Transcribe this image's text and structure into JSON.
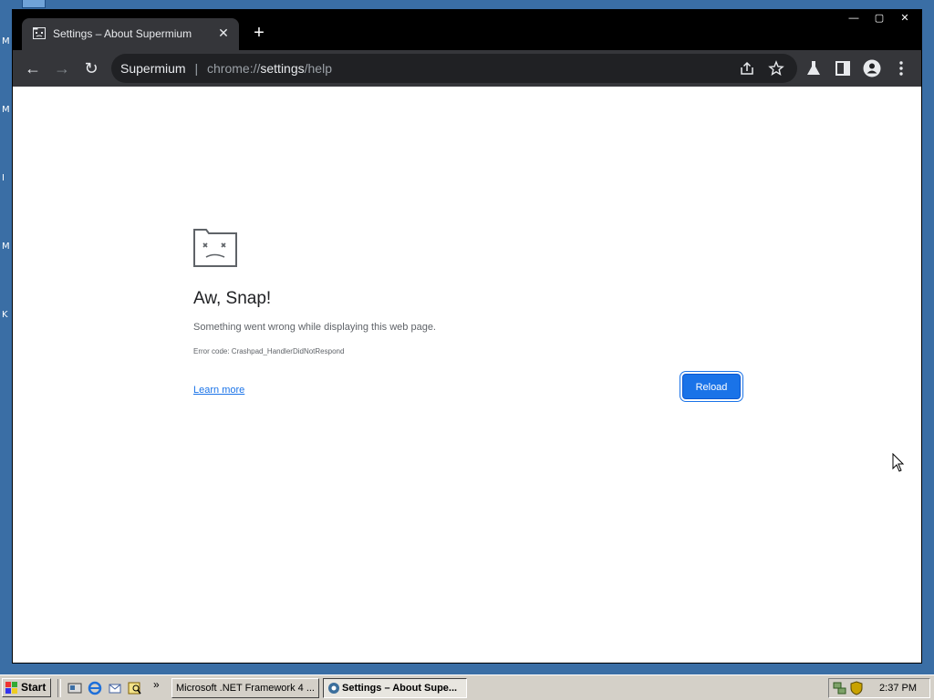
{
  "desktop": {
    "edge_letters": [
      "M",
      "M",
      "I",
      "M",
      "K"
    ]
  },
  "browser": {
    "tab": {
      "title": "Settings – About Supermium",
      "close_glyph": "✕"
    },
    "new_tab_glyph": "+",
    "window_controls": {
      "minimize": "—",
      "maximize": "▢",
      "close": "✕"
    },
    "toolbar": {
      "back_glyph": "←",
      "forward_glyph": "→",
      "reload_glyph": "↻",
      "omnibox": {
        "site_name": "Supermium",
        "separator": "|",
        "url_scheme": "chrome://",
        "url_host": "settings",
        "url_path": "/help"
      }
    }
  },
  "crash_page": {
    "title": "Aw, Snap!",
    "message": "Something went wrong while displaying this web page.",
    "error_code": "Error code: Crashpad_HandlerDidNotRespond",
    "learn_more": "Learn more",
    "reload_button": "Reload"
  },
  "taskbar": {
    "start_label": "Start",
    "chevron": "»",
    "tasks": [
      {
        "label": "Microsoft .NET Framework 4 ...",
        "active": false
      },
      {
        "label": "Settings – About Supe...",
        "active": true
      }
    ],
    "clock": "2:37 PM"
  },
  "colors": {
    "accent": "#1a73e8",
    "titlebar": "#000000",
    "toolbar": "#35363a",
    "desktop": "#3a6ea5",
    "taskbar": "#d4d0c8"
  }
}
